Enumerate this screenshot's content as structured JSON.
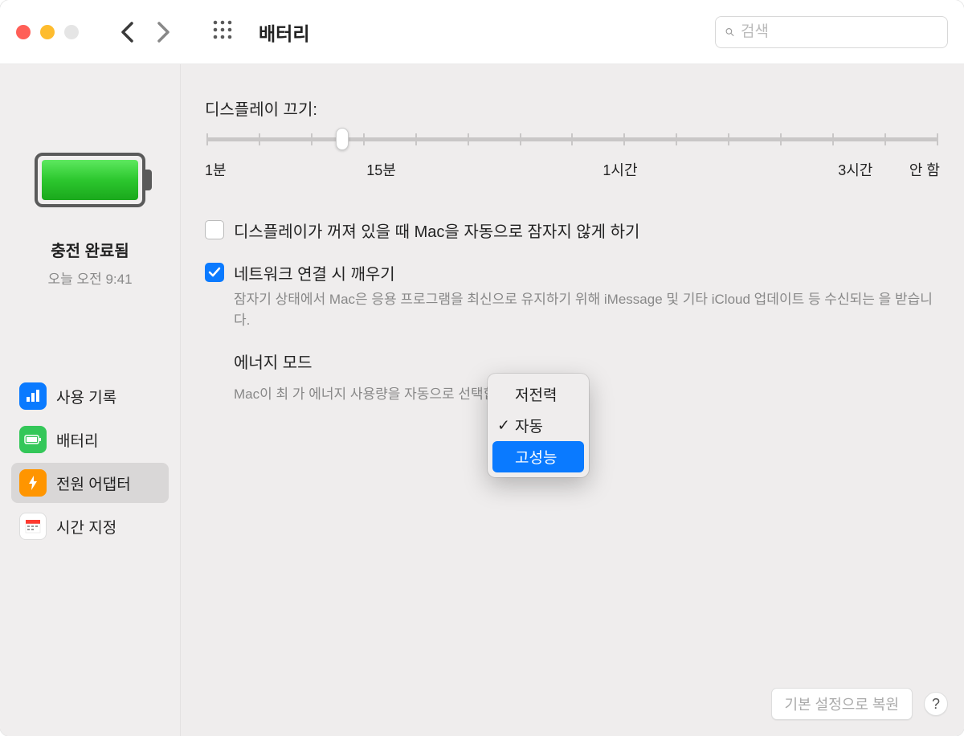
{
  "titlebar": {
    "title": "배터리",
    "search_placeholder": "검색"
  },
  "sidebar": {
    "battery_status": "충전 완료됨",
    "battery_time": "오늘 오전 9:41",
    "items": [
      {
        "label": "사용 기록",
        "icon": "chart"
      },
      {
        "label": "배터리",
        "icon": "battery"
      },
      {
        "label": "전원 어댑터",
        "icon": "bolt"
      },
      {
        "label": "시간 지정",
        "icon": "calendar"
      }
    ]
  },
  "main": {
    "display_off_label": "디스플레이 끄기:",
    "slider_labels": {
      "l1": "1분",
      "l2": "15분",
      "l3": "1시간",
      "l4": "3시간",
      "l5": "안 함"
    },
    "checkbox1_label": "디스플레이가 꺼져 있을 때 Mac을 자동으로 잠자지 않게 하기",
    "checkbox2_label": "네트워크 연결 시 깨우기",
    "checkbox2_desc": "잠자기 상태에서 Mac은 응용 프로그램을 최신으로 유지하기 위해 iMessage 및 기타 iCloud 업데이트 등 수신되는                             을 받습니다.",
    "energy_label": "에너지 모드",
    "energy_desc": "Mac이 최                       가 에너지 사용량을 자동으로 선택합니다.",
    "dropdown": {
      "opt1": "저전력",
      "opt2": "자동",
      "opt3": "고성능"
    },
    "restore_btn": "기본 설정으로 복원",
    "help": "?"
  }
}
